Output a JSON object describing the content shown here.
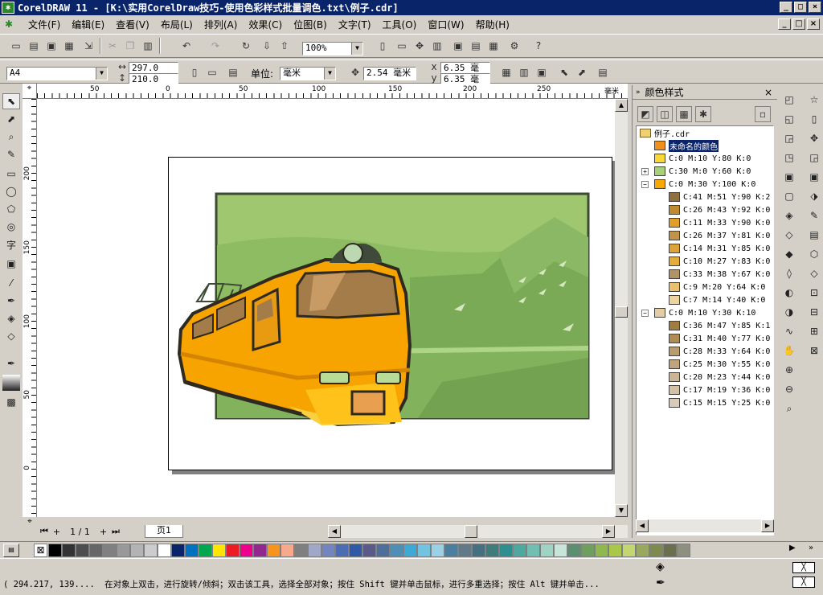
{
  "window": {
    "title": "CorelDRAW 11 - [K:\\实用CorelDraw技巧-使用色彩样式批量调色.txt\\例子.cdr]",
    "minimize": "_",
    "maximize": "□",
    "close": "×"
  },
  "menu": [
    "文件(F)",
    "编辑(E)",
    "查看(V)",
    "布局(L)",
    "排列(A)",
    "效果(C)",
    "位图(B)",
    "文字(T)",
    "工具(O)",
    "窗口(W)",
    "帮助(H)"
  ],
  "toolbar": {
    "zoom": "100%"
  },
  "propbar": {
    "paper_size": "A4",
    "width": "297.0",
    "height": "210.0",
    "units_label": "单位:",
    "units": "毫米",
    "nudge": "2.54 毫米",
    "dup_x": "6.35 毫",
    "dup_y": "6.35 毫",
    "x_label": "x",
    "y_label": "y"
  },
  "ruler": {
    "h_ticks": [
      "50",
      "0",
      "50",
      "100",
      "150",
      "200",
      "250"
    ],
    "h_unit": "毫米",
    "v_ticks": [
      "200",
      "150",
      "100",
      "50",
      "0"
    ]
  },
  "pagenav": {
    "counter": "1 / 1",
    "tab": "页1"
  },
  "docker": {
    "title": "颜色样式",
    "file": "例子.cdr",
    "items": [
      {
        "label": "未命名的颜色",
        "color": "#f0901c",
        "level": 1,
        "selected": true,
        "expander": ""
      },
      {
        "label": "C:0 M:10 Y:80 K:0",
        "color": "#f8d838",
        "level": 1,
        "expander": ""
      },
      {
        "label": "C:30 M:0 Y:60 K:0",
        "color": "#a8d078",
        "level": 1,
        "expander": "+"
      },
      {
        "label": "C:0 M:30 Y:100 K:0",
        "color": "#f8a800",
        "level": 1,
        "expander": "−"
      },
      {
        "label": "C:41 M:51 Y:90 K:2",
        "color": "#907040",
        "level": 2
      },
      {
        "label": "C:26 M:43 Y:92 K:0",
        "color": "#c08a30",
        "level": 2
      },
      {
        "label": "C:11 M:33 Y:90 K:0",
        "color": "#e0a028",
        "level": 2
      },
      {
        "label": "C:26 M:37 Y:81 K:0",
        "color": "#c09448",
        "level": 2
      },
      {
        "label": "C:14 M:31 Y:85 K:0",
        "color": "#dca438",
        "level": 2
      },
      {
        "label": "C:10 M:27 Y:83 K:0",
        "color": "#e4ac38",
        "level": 2
      },
      {
        "label": "C:33 M:38 Y:67 K:0",
        "color": "#b09468",
        "level": 2
      },
      {
        "label": "C:9 M:20 Y:64 K:0",
        "color": "#e8c070",
        "level": 2
      },
      {
        "label": "C:7 M:14 Y:40 K:0",
        "color": "#ecd4a0",
        "level": 2
      },
      {
        "label": "C:0 M:10 Y:30 K:10",
        "color": "#e4cca4",
        "level": 1,
        "expander": "−"
      },
      {
        "label": "C:36 M:47 Y:85 K:1",
        "color": "#a07c40",
        "level": 2
      },
      {
        "label": "C:31 M:40 Y:77 K:0",
        "color": "#b08c54",
        "level": 2
      },
      {
        "label": "C:28 M:33 Y:64 K:0",
        "color": "#b89c70",
        "level": 2
      },
      {
        "label": "C:25 M:30 Y:55 K:0",
        "color": "#c0a47c",
        "level": 2
      },
      {
        "label": "C:20 M:23 Y:44 K:0",
        "color": "#ccb494",
        "level": 2
      },
      {
        "label": "C:17 M:19 Y:36 K:0",
        "color": "#d4c0a4",
        "level": 2
      },
      {
        "label": "C:15 M:15 Y:25 K:0",
        "color": "#d8ccb8",
        "level": 2
      }
    ]
  },
  "palette": [
    "#ffffff",
    "#000000",
    "#333333",
    "#4d4d4d",
    "#666666",
    "#808080",
    "#999999",
    "#b3b3b3",
    "#cccccc",
    "#ffffff",
    "#0a246a",
    "#0070c0",
    "#00a650",
    "#ffe600",
    "#ed1c24",
    "#ec008c",
    "#92278f",
    "#f7941d",
    "#f9a98b",
    "#7f7f7f",
    "#9fa8c9",
    "#7385c0",
    "#4c6cb3",
    "#2e5aa8",
    "#5a5a8a",
    "#4e6f9c",
    "#4f8fb5",
    "#3fa9d6",
    "#71c3e1",
    "#9ad1e6",
    "#4a7f9f",
    "#607a8a",
    "#46707f",
    "#3f7c7c",
    "#2f8f8f",
    "#4fa8a0",
    "#72bfb1",
    "#9fd3c4",
    "#c7e5d8",
    "#5b8f6f",
    "#6f9f5f",
    "#8fb84f",
    "#a9c84a",
    "#c3d66f",
    "#9aa85f",
    "#7f8a4f",
    "#6b6f4f",
    "#8f8f7f"
  ],
  "status": {
    "coords": "( 294.217, 139....",
    "message": "在对象上双击，进行旋转/倾斜；双击该工具，选择全部对象；按住 Shift 键并单击鼠标，进行多重选择；按住 Alt 键并单击..."
  }
}
